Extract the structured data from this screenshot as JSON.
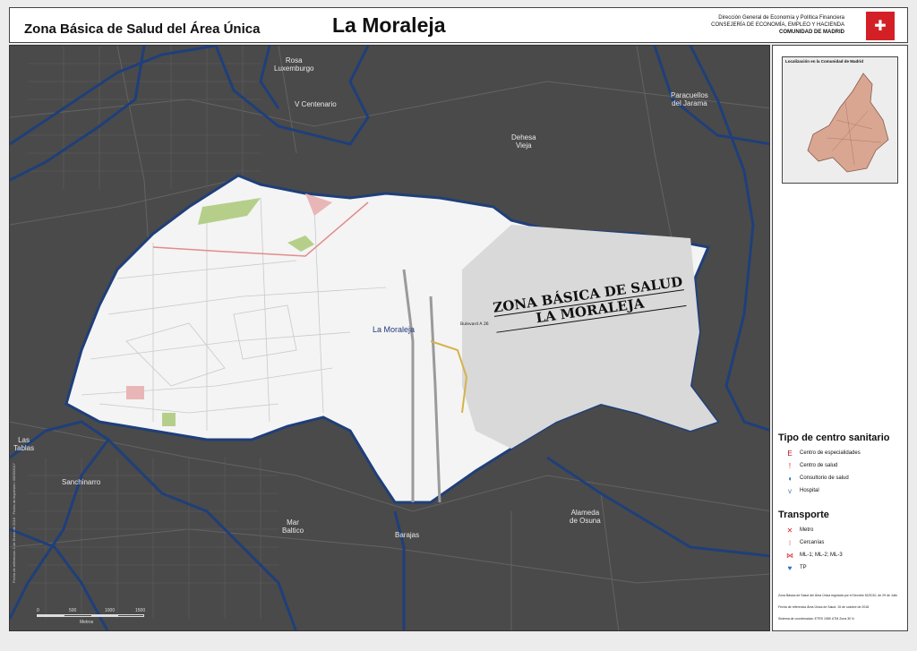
{
  "header": {
    "zone_title": "Zona Básica de Salud del Área Única",
    "area_title": "La Moraleja",
    "org_line1": "Dirección General de Economía y Política Financiera",
    "org_line2": "CONSEJERÍA DE ECONOMÍA, EMPLEO Y HACIENDA",
    "org_line3": "COMUNIDAD DE MADRID",
    "logo_icon": "comunidad-de-madrid-logo"
  },
  "map": {
    "places": {
      "rosa_luxemburgo": "Rosa\nLuxemburgo",
      "v_centenario": "V Centenario",
      "paracuellos": "Paracuellos\ndel Jarama",
      "dehesa_vieja": "Dehesa\nVieja",
      "la_moraleja": "La Moraleja",
      "las_tablas": "Las\nTablas",
      "sanchinarro": "Sanchinarro",
      "mar_baltico": "Mar\nBaltico",
      "barajas": "Barajas",
      "alameda": "Alameda\nde Osuna"
    },
    "zone_label_line1": "ZONA BÁSICA DE SALUD",
    "zone_label_line2": "LA MORALEJA",
    "side_note": "Fecha de referencia: 1 de Enero de 2018 · Fecha de impresión: 09/05/2017",
    "scale": {
      "l0": "0",
      "l1": "500",
      "l2": "1000",
      "l3": "1500",
      "unit": "Metros"
    },
    "colors": {
      "background": "#4a4a4a",
      "zone": "#f4f4f4",
      "boundary": "#1f3f7a",
      "roads": "#6c6c6c"
    }
  },
  "sidebar": {
    "inset_title": "Localización en la Comunidad de Madrid",
    "legend_title": "Tipo de centro sanitario",
    "centro_items": [
      {
        "icon": "centro-especialidades-icon",
        "label": "Centro de especialidades"
      },
      {
        "icon": "centro-salud-icon",
        "label": "Centro de salud"
      },
      {
        "icon": "consultorio-icon",
        "label": "Consultorio de salud"
      },
      {
        "icon": "hospital-icon",
        "label": "Hospital"
      }
    ],
    "transport_title": "Transporte",
    "transport_items": [
      {
        "icon": "metro-icon",
        "label": "Metro"
      },
      {
        "icon": "cercanias-icon",
        "label": "Cercanías"
      },
      {
        "icon": "metro-ligero-icon",
        "label": "ML-1; ML-2; ML-3"
      },
      {
        "icon": "tp-icon",
        "label": "TP"
      }
    ],
    "note1": "Zona Básica de Salud del Área Única regulada por el Decreto 52/2010, de 29 de Julio",
    "note2": "Fecha de referencia Área Única de Salud: 15 de octubre de 2018",
    "note3": "Sistema de coordenadas: ETRS 1989 UTM Zona 30 N"
  }
}
